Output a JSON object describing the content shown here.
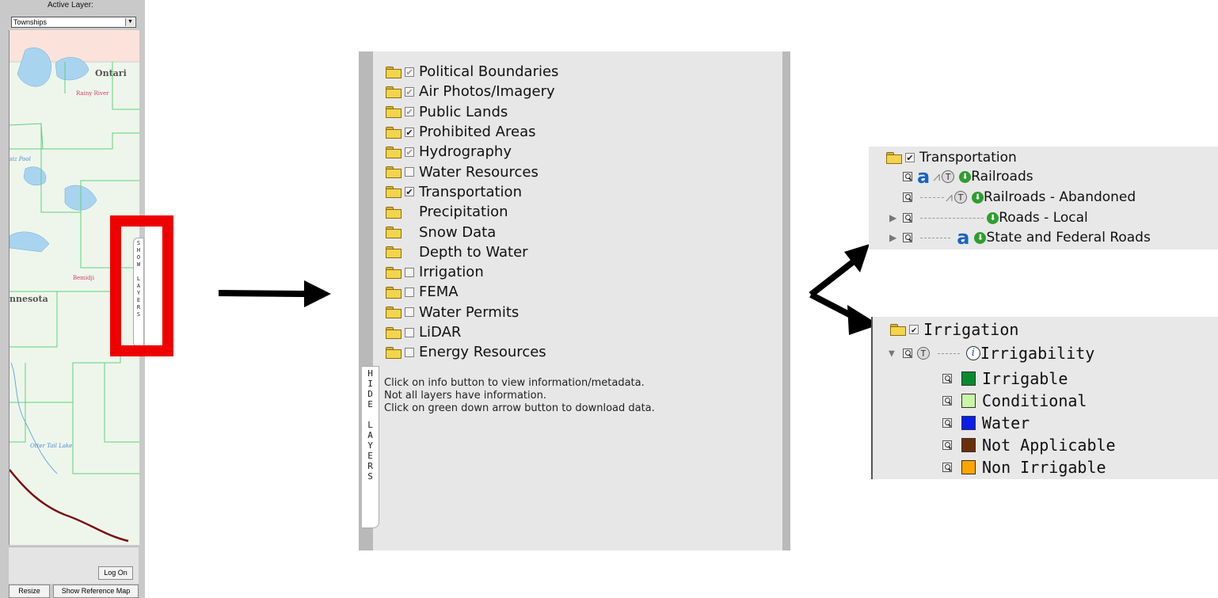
{
  "left_panel": {
    "active_layer_label": "Active Layer:",
    "active_layer_value": "Townships",
    "map_labels": {
      "ontario": "Ontari",
      "rainy_river": "Rainy River",
      "pool": "siz Pool",
      "bemidji": "Bemidji",
      "minnesota": "nnesota",
      "otter_tail": "Otter Tail Lake"
    },
    "show_layers_tab": [
      "S",
      "H",
      "O",
      "W",
      "",
      "L",
      "A",
      "Y",
      "E",
      "R",
      "S"
    ],
    "log_on_button": "Log On",
    "resize_button": "Resize",
    "reference_map_button": "Show Reference Map"
  },
  "middle_panel": {
    "layers": [
      {
        "label": "Political Boundaries",
        "check": "grey"
      },
      {
        "label": "Air Photos/Imagery",
        "check": "grey"
      },
      {
        "label": "Public Lands",
        "check": "grey"
      },
      {
        "label": "Prohibited Areas",
        "check": "checked"
      },
      {
        "label": "Hydrography",
        "check": "grey"
      },
      {
        "label": "Water Resources",
        "check": "empty"
      },
      {
        "label": "Transportation",
        "check": "checked"
      },
      {
        "label": "Precipitation",
        "check": "none"
      },
      {
        "label": "Snow Data",
        "check": "none"
      },
      {
        "label": "Depth to Water",
        "check": "none"
      },
      {
        "label": "Irrigation",
        "check": "empty"
      },
      {
        "label": "FEMA",
        "check": "empty"
      },
      {
        "label": "Water Permits",
        "check": "empty"
      },
      {
        "label": "LiDAR",
        "check": "empty"
      },
      {
        "label": "Energy Resources",
        "check": "empty"
      }
    ],
    "hide_layers_tab": [
      "H",
      "I",
      "D",
      "E",
      "",
      "L",
      "A",
      "Y",
      "E",
      "R",
      "S"
    ],
    "info_lines": {
      "line1": "Click on info button to view information/metadata.",
      "line2": "Not all layers have information.",
      "line3": "Click on green down arrow button to download data."
    }
  },
  "transportation_panel": {
    "title": "Transportation",
    "items": {
      "railroads": "Railroads",
      "railroads_abandoned": "Railroads - Abandoned",
      "roads_local": "Roads - Local",
      "state_federal": "State and Federal Roads"
    }
  },
  "irrigation_panel": {
    "title": "Irrigation",
    "sublayer": "Irrigability",
    "legend": [
      {
        "label": "Irrigable",
        "color": "#0a8a2e"
      },
      {
        "label": "Conditional",
        "color": "#c8f5a8"
      },
      {
        "label": "Water",
        "color": "#0a1ee8"
      },
      {
        "label": "Not Applicable",
        "color": "#6b2f0c"
      },
      {
        "label": "Non Irrigable",
        "color": "#ffa500"
      }
    ]
  },
  "colors": {
    "highlight": "#ee0000",
    "map_background": "#eef6ec",
    "map_lines": "#5fd17a",
    "water": "#a9d4f0",
    "panel_bg": "#e7e7e7"
  }
}
